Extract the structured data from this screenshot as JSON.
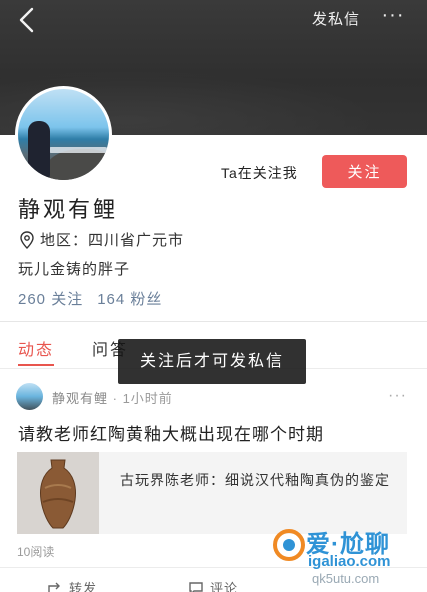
{
  "header": {
    "message_label": "发私信",
    "more_label": "···"
  },
  "profile": {
    "follows_me": "Ta在关注我",
    "follow_button": "关注",
    "nickname": "静观有鲤",
    "region": "地区：四川省广元市",
    "bio": "玩儿金铸的胖子",
    "following": "260 关注",
    "followers": "164 粉丝"
  },
  "tabs": [
    {
      "label": "动态",
      "active": true
    },
    {
      "label": "问答",
      "active": false
    }
  ],
  "toast": "关注后才可发私信",
  "post": {
    "author": "静观有鲤",
    "time": " · 1小时前",
    "more_label": "···",
    "title": "请教老师红陶黄釉大概出现在哪个时期",
    "link_text": "古玩界陈老师：细说汉代釉陶真伪的鉴定",
    "reads": "10阅读",
    "share_label": "转发",
    "comment_label": "评论"
  },
  "watermark": {
    "brand": "爱·尬聊",
    "url": "igaliao.com",
    "url2": "qk5utu.com"
  },
  "colors": {
    "accent": "#e8554e",
    "follow_button": "#ee5a5a",
    "stats_text": "#6a7f99",
    "cover": "#333333"
  }
}
